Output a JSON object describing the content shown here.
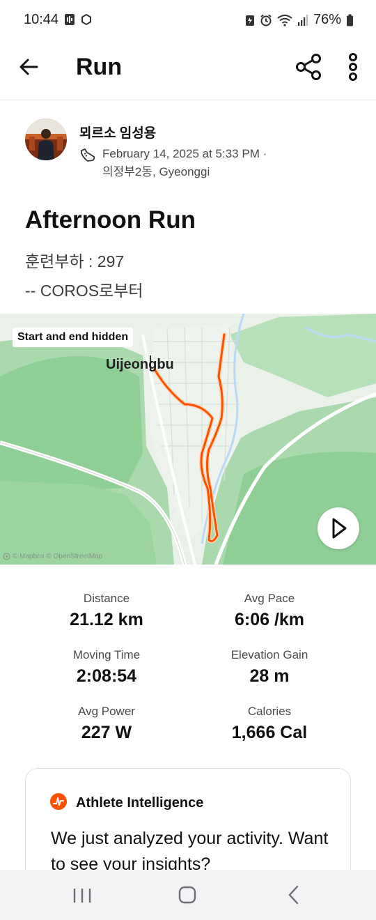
{
  "status_bar": {
    "time": "10:44",
    "battery": "76%"
  },
  "app_bar": {
    "title": "Run"
  },
  "athlete": {
    "name": "뫼르소 임성용",
    "date_line": "February 14, 2025 at 5:33 PM ·",
    "location_line": "의정부2동, Gyeonggi"
  },
  "activity": {
    "title": "Afternoon Run",
    "description": [
      "훈련부하 : 297",
      "-- COROS로부터"
    ]
  },
  "map": {
    "badge": "Start and end hidden",
    "city_label": "Uijeongbu",
    "attribution": "© Mapbox © OpenStreetMap",
    "route_color": "#fc5200"
  },
  "stats": [
    {
      "label": "Distance",
      "value": "21.12 km"
    },
    {
      "label": "Avg Pace",
      "value": "6:06 /km"
    },
    {
      "label": "Moving Time",
      "value": "2:08:54"
    },
    {
      "label": "Elevation Gain",
      "value": "28 m"
    },
    {
      "label": "Avg Power",
      "value": "227 W"
    },
    {
      "label": "Calories",
      "value": "1,666 Cal"
    }
  ],
  "insight_card": {
    "title": "Athlete Intelligence",
    "text": "We just analyzed your activity. Want to see your insights?"
  },
  "colors": {
    "accent": "#fc5200",
    "map_green": "#a9d9ad",
    "map_base": "#e9f1e9"
  },
  "icons": [
    "back-arrow-icon",
    "share-icon",
    "more-vertical-icon",
    "shoe-icon",
    "play-icon",
    "athlete-intelligence-icon",
    "recents-icon",
    "home-icon",
    "nav-back-icon"
  ]
}
